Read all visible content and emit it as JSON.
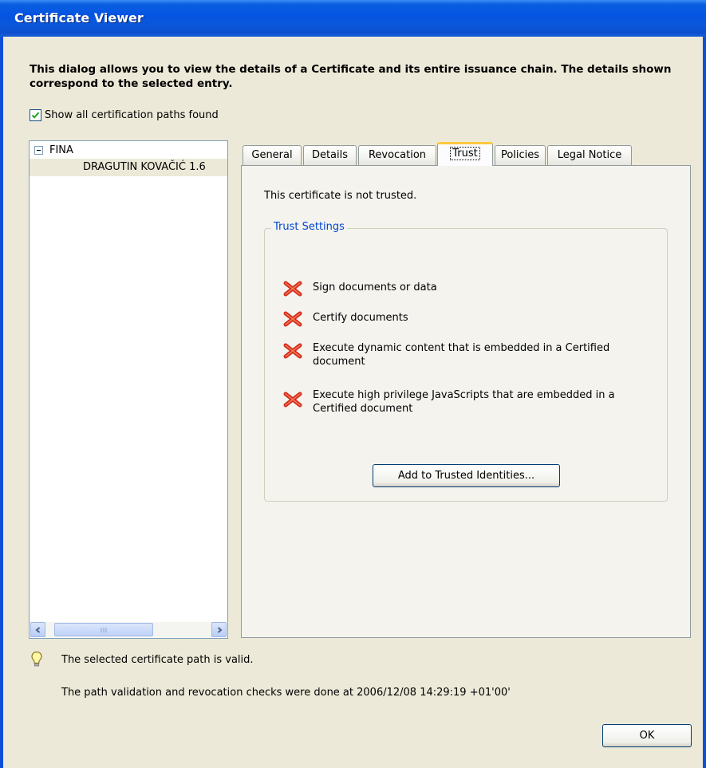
{
  "window": {
    "title": "Certificate Viewer"
  },
  "intro": "This dialog allows you to view the details of a Certificate and its entire issuance chain. The details shown correspond to the selected entry.",
  "show_paths": {
    "label": "Show all certification paths found",
    "checked": true
  },
  "tree": {
    "root": "FINA",
    "child": "DRAGUTIN KOVAČIĆ 1.6"
  },
  "tabs": [
    {
      "label": "General"
    },
    {
      "label": "Details"
    },
    {
      "label": "Revocation"
    },
    {
      "label": "Trust",
      "active": true
    },
    {
      "label": "Policies"
    },
    {
      "label": "Legal Notice"
    }
  ],
  "trust": {
    "status": "This certificate is not trusted.",
    "group_label": "Trust Settings",
    "items": [
      "Sign documents or data",
      "Certify documents",
      "Execute dynamic content that is embedded in a Certified document",
      "Execute high privilege JavaScripts that are embedded in a Certified document"
    ],
    "add_button": "Add to Trusted Identities..."
  },
  "status": {
    "valid": "The selected certificate path is valid.",
    "checks": "The path validation and revocation checks were done at 2006/12/08 14:29:19 +01'00'"
  },
  "buttons": {
    "ok": "OK"
  },
  "colors": {
    "titlebar": "#0554e3",
    "group_label": "#0046d5",
    "active_tab_accent": "#ffc83c",
    "deny_icon": "#d42a1a"
  }
}
